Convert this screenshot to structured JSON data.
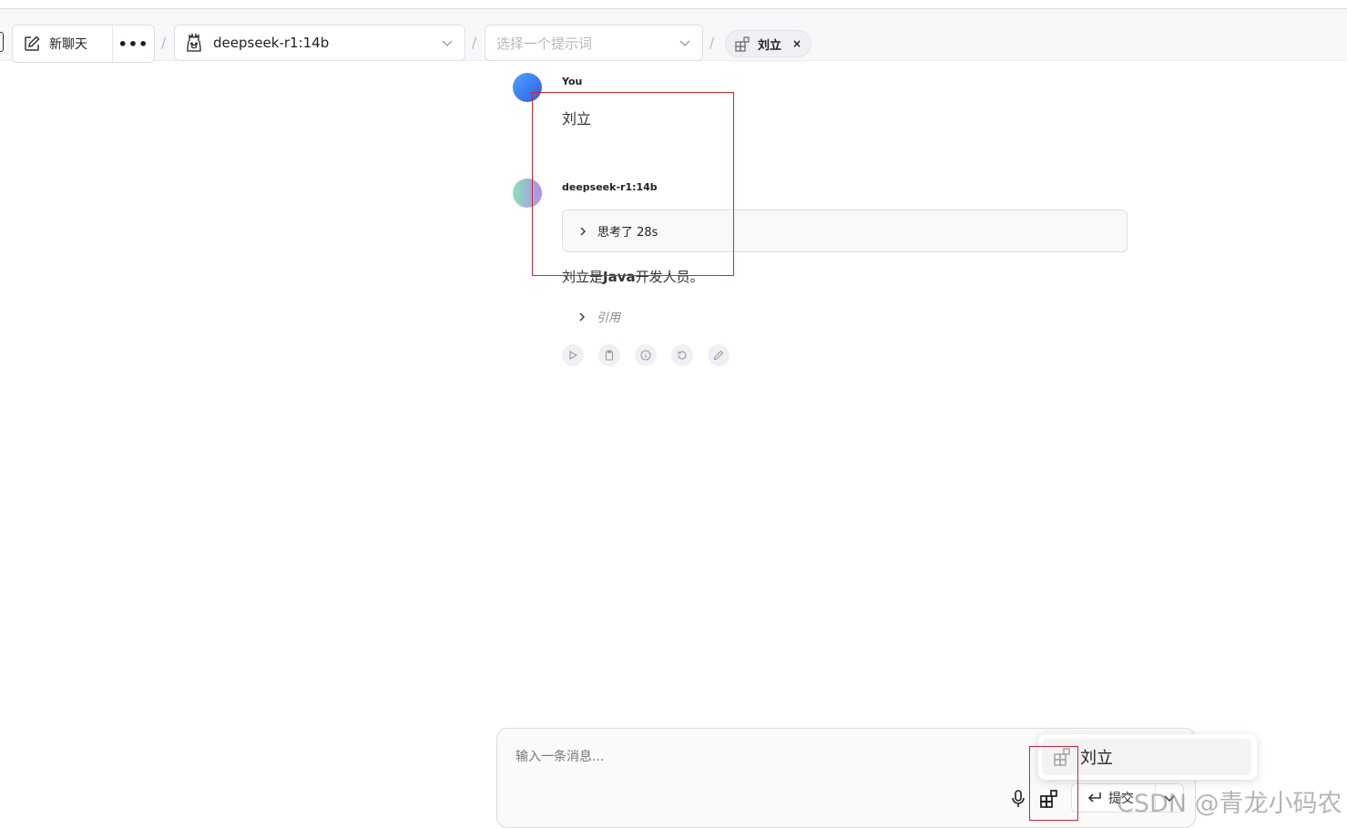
{
  "header": {
    "new_chat_label": "新聊天",
    "more_label": "•••",
    "separator": "/",
    "model_select_value": "deepseek-r1:14b",
    "prompt_select_placeholder": "选择一个提示词",
    "knowledge_tag": "刘立",
    "knowledge_tag_close": "×"
  },
  "conversation": {
    "user": {
      "name": "You",
      "message": "刘立"
    },
    "assistant": {
      "name": "deepseek-r1:14b",
      "thinking_label": "思考了 28s",
      "answer_prefix": "刘立是",
      "answer_bold": "Java",
      "answer_suffix": "开发人员。",
      "citation_label": "引用",
      "actions": [
        "play-icon",
        "clipboard-icon",
        "info-icon",
        "regenerate-icon",
        "edit-icon"
      ]
    }
  },
  "composer": {
    "placeholder": "输入一条消息...",
    "send_label": "提交",
    "knowledge_popup_item": "刘立"
  },
  "watermark": "CSDN @青龙小码农",
  "colors": {
    "highlight": "#d6232f",
    "user_avatar": "#2d5be3"
  }
}
